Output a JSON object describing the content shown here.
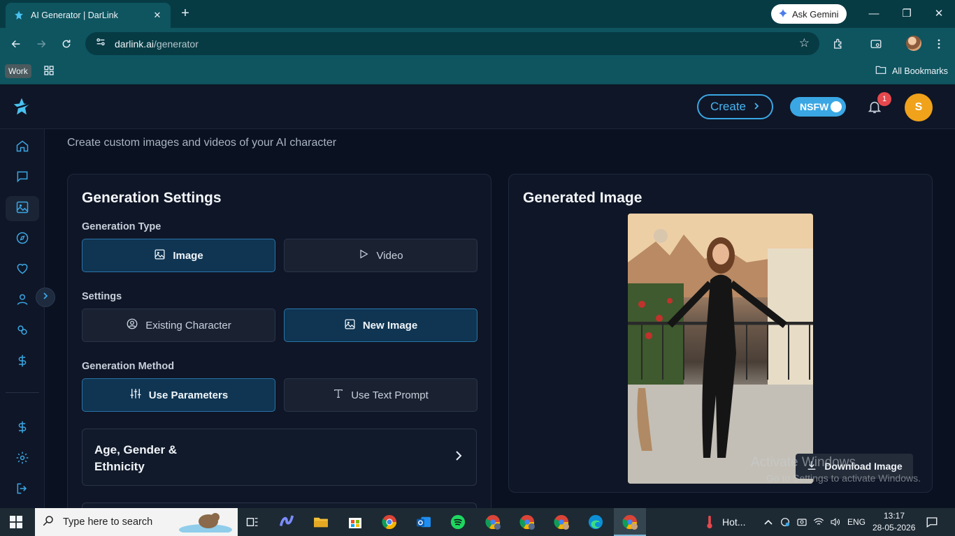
{
  "browser": {
    "tab_title": "AI Generator | DarLink",
    "new_tab": "+",
    "ask_gemini": "Ask Gemini",
    "url_host": "darlink.ai",
    "url_path": "/generator",
    "work_label": "Work",
    "all_bookmarks": "All Bookmarks"
  },
  "header": {
    "create_label": "Create",
    "nsfw_label": "NSFW",
    "notification_count": "1",
    "avatar_initial": "S"
  },
  "page": {
    "subtitle": "Create custom images and videos of your AI character"
  },
  "settings_panel": {
    "title": "Generation Settings",
    "generation_type_label": "Generation Type",
    "type_image": "Image",
    "type_video": "Video",
    "settings_label": "Settings",
    "existing_character": "Existing Character",
    "new_image": "New Image",
    "generation_method_label": "Generation Method",
    "use_parameters": "Use Parameters",
    "use_text_prompt": "Use Text Prompt",
    "accordion_title": "Age, Gender & Ethnicity"
  },
  "result_panel": {
    "title": "Generated Image",
    "download_label": "Download Image"
  },
  "watermark": {
    "line1": "Activate Windows",
    "line2": "Go to Settings to activate Windows."
  },
  "taskbar": {
    "search_placeholder": "Type here to search",
    "weather": "Hot...",
    "language": "ENG",
    "time": "13:17",
    "date": "28-05-2026"
  },
  "colors": {
    "accent": "#3aa7e4",
    "selected_bg": "#0f3552",
    "app_bg": "#0a1120",
    "avatar": "#f0a21b",
    "badge": "#e5484d"
  }
}
